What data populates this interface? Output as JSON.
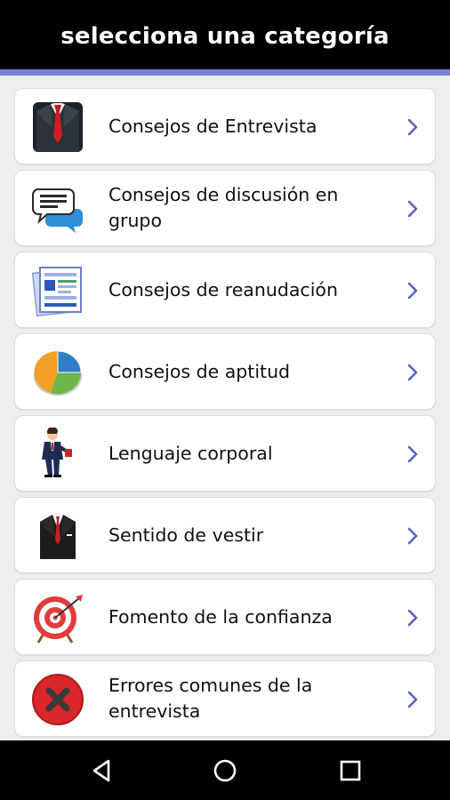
{
  "header": {
    "title": "selecciona una categoría"
  },
  "colors": {
    "accent": "#7b7fd6",
    "chevron": "#5c5fc6",
    "bar": "#000000"
  },
  "categories": [
    {
      "label": "Consejos de Entrevista",
      "icon": "suit-tie-icon"
    },
    {
      "label": "Consejos de discusión en grupo",
      "icon": "chat-bubbles-icon"
    },
    {
      "label": "Consejos de reanudación",
      "icon": "resume-document-icon"
    },
    {
      "label": "Consejos de aptitud",
      "icon": "pie-chart-icon"
    },
    {
      "label": "Lenguaje corporal",
      "icon": "businessman-icon"
    },
    {
      "label": "Sentido de vestir",
      "icon": "suit-jacket-icon"
    },
    {
      "label": "Fomento de la confianza",
      "icon": "target-dart-icon"
    },
    {
      "label": "Errores comunes de la entrevista",
      "icon": "red-x-icon"
    }
  ],
  "navbar": {
    "back": "back-icon",
    "home": "home-icon",
    "recents": "recents-icon"
  }
}
